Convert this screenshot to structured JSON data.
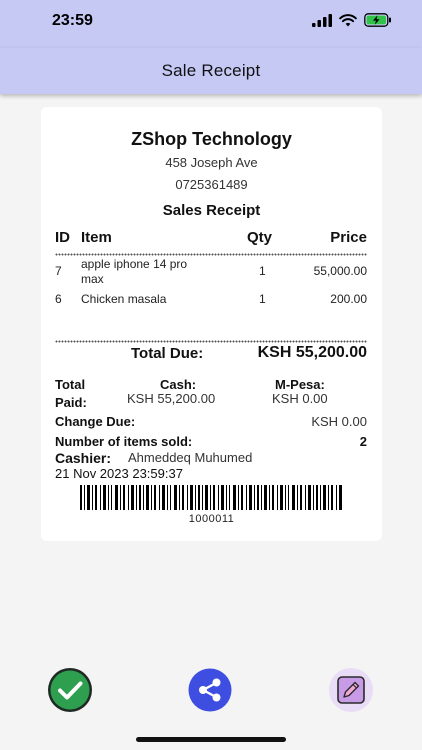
{
  "status_bar": {
    "time": "23:59"
  },
  "app_bar": {
    "title": "Sale Receipt"
  },
  "receipt": {
    "shop_name": "ZShop Technology",
    "address": "458 Joseph Ave",
    "phone": "0725361489",
    "title": "Sales Receipt",
    "columns": {
      "id": "ID",
      "item": "Item",
      "qty": "Qty",
      "price": "Price"
    },
    "rows": [
      {
        "id": "7",
        "item_line1": "apple iphone 14 pro",
        "item_line2": "max",
        "qty": "1",
        "price": "55,000.00"
      },
      {
        "id": "6",
        "item_line1": "Chicken masala",
        "item_line2": "",
        "qty": "1",
        "price": "200.00"
      }
    ],
    "total_due_label": "Total Due:",
    "total_due_value": "KSH 55,200.00",
    "total_paid_label_1": "Total",
    "total_paid_label_2": "Paid:",
    "cash_label": "Cash:",
    "cash_value": "KSH 55,200.00",
    "mpesa_label": "M-Pesa:",
    "mpesa_value": "KSH 0.00",
    "change_due_label": "Change Due:",
    "change_due_value": "KSH 0.00",
    "items_sold_label": "Number of items sold:",
    "items_sold_value": "2",
    "cashier_label": "Cashier:",
    "cashier_name": "Ahmeddeq Muhumed",
    "datetime": "21 Nov 2023 23:59:37",
    "barcode_number": "1000011"
  },
  "actions": {
    "confirm_icon": "check-icon",
    "share_icon": "share-icon",
    "edit_icon": "pencil-icon",
    "confirm_color": "#2e9e4f",
    "share_color": "#3d4ee0",
    "edit_color": "#c79be6"
  }
}
